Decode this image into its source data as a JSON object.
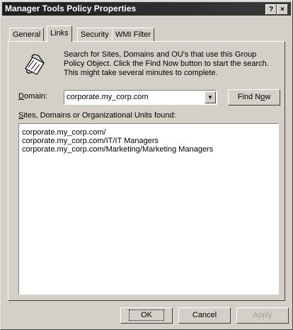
{
  "window": {
    "title": "Manager Tools Policy Properties"
  },
  "titlebar": {
    "help_glyph": "?",
    "close_glyph": "×"
  },
  "tabs": [
    {
      "label": "General"
    },
    {
      "label": "Links"
    },
    {
      "label": "Security"
    },
    {
      "label": "WMI Filter"
    }
  ],
  "active_tab": "Links",
  "links": {
    "description": "Search for Sites, Domains and OU's that use this Group Policy Object. Click the Find Now button to start the search. This might take several minutes to complete.",
    "domain_label_prefix": "D",
    "domain_label_rest": "omain:",
    "domain_value": "corporate.my_corp.com",
    "find_now_prefix": "Find N",
    "find_now_u": "o",
    "find_now_rest": "w",
    "found_label_prefix": "S",
    "found_label_rest": "ites, Domains or Organizational Units found:",
    "results": [
      "corporate.my_corp.com/",
      "corporate.my_corp.com/IT/IT Managers",
      "corporate.my_corp.com/Marketing/Marketing Managers"
    ]
  },
  "footer": {
    "ok_label": "OK",
    "cancel_label": "Cancel",
    "apply_label": "Apply"
  },
  "icon_name": "search-links-icon"
}
